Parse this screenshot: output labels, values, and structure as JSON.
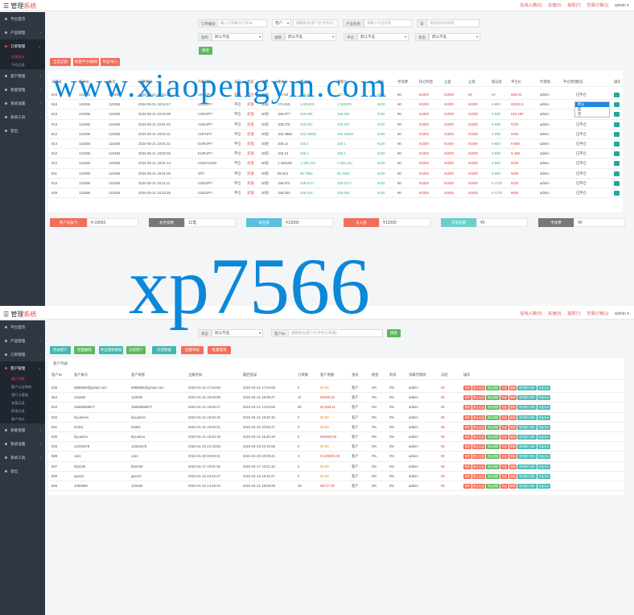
{
  "brand": {
    "title": "管理",
    "accent": "系统"
  },
  "topbar": {
    "links": [
      "在线人数(0)",
      "充值(0)",
      "提现(7)",
      "交易订单(1)"
    ],
    "user": "admin ▾"
  },
  "sidebar": {
    "items": [
      {
        "label": "平台首页"
      },
      {
        "label": "产品管理"
      },
      {
        "label": "订单管理"
      },
      {
        "label": "客户管理"
      },
      {
        "label": "资金管理"
      },
      {
        "label": "系统设置"
      },
      {
        "label": "系统工具"
      },
      {
        "label": "退出"
      }
    ],
    "subs1": [
      "交易流水",
      "平仓记录"
    ],
    "subs2": [
      "客户列表",
      "客户认证审核",
      "银行卡管理",
      "充值记录",
      "提现记录",
      "客户流水"
    ]
  },
  "filters1": {
    "order_no_label": "订单编号",
    "order_no_placeholder": "输入订单编号/订单ID",
    "client_select": "客户",
    "client_placeholder": "模糊查询(客户名/手机号)",
    "product_label": "产品名称",
    "product_placeholder": "请输入产品名称",
    "date_label": "日",
    "date_placeholder": "请选择开始日期",
    "row2": [
      {
        "label": "盈利",
        "value": "默认不选"
      },
      {
        "label": "涨跌",
        "value": "默认不选"
      },
      {
        "label": "平仓",
        "value": "默认不选"
      },
      {
        "label": "状态",
        "value": "默认不选"
      }
    ],
    "search": "搜索"
  },
  "actions1": {
    "a": "全选全部",
    "b": "批量平仓/删除",
    "c": "导出/导入"
  },
  "orders": {
    "headers": [
      "订单号",
      "客户ID",
      "账号",
      "订单时间",
      "产品代码",
      "方向",
      "状态",
      "手数",
      "建仓价",
      "建仓价",
      "最新价",
      "盈亏",
      "手续费",
      "持仓利息",
      "止盈",
      "止损",
      "保证金",
      "平仓价",
      "代理商",
      "平仓原因",
      "状态"
    ],
    "rows": [
      [
        "816",
        "123456",
        "123456",
        "2024-05-21 19:04:17",
        "USD/JPY",
        "买涨",
        "持仓",
        "30倍",
        "157.83",
        "158.221",
        "157.824",
        "¥100",
        "¥0",
        "¥1000",
        "¥1000",
        "¥0",
        "¥0",
        "¥95.03",
        "admin",
        "",
        "已平仓"
      ],
      [
        "815",
        "123456",
        "123456",
        "2024-05-21 19:04:17",
        "USD/JPY",
        "平仓",
        "买涨",
        "30倍",
        "171.815",
        "1.025576",
        "1.025576",
        "¥100",
        "¥0",
        "¥1000",
        "¥1000",
        "¥1000",
        "¥-880",
        "¥9153.8",
        "admin",
        "",
        "已平仓"
      ],
      [
        "813",
        "123456",
        "123456",
        "2024-05-21 19:03:39",
        "USD/JPY",
        "平仓",
        "买涨",
        "30倍",
        "156.977",
        "156.984",
        "156.984",
        "¥100",
        "¥0",
        "¥1000",
        "¥1000",
        "¥1000",
        "¥-880",
        "¥10,290",
        "admin",
        "",
        "已平仓"
      ],
      [
        "813",
        "123456",
        "123456",
        "2024-05-21 19:01:46",
        "AUD/JPY",
        "平仓",
        "买涨",
        "30倍",
        "108.278",
        "100.257",
        "100.257",
        "¥100",
        "¥0",
        "¥1000",
        "¥1000",
        "¥1000",
        "¥-880",
        "¥720",
        "admin",
        "",
        "已平仓"
      ],
      [
        "812",
        "123456",
        "123456",
        "2024-05-21 19:01:31",
        "CHF/JPY",
        "平仓",
        "买涨",
        "30倍",
        "162.4868",
        "163.20884",
        "163.20884",
        "¥100",
        "¥0",
        "¥1000",
        "¥1000",
        "¥1000",
        "¥-880",
        "¥160",
        "admin",
        "",
        "已平仓"
      ],
      [
        "814",
        "123456",
        "123456",
        "2024-05-21 19:01:31",
        "EUR/JPY",
        "平仓",
        "买涨",
        "30倍",
        "105.12",
        "105.1",
        "105.1",
        "¥100",
        "¥0",
        "¥1000",
        "¥1000",
        "¥1000",
        "¥-880",
        "¥-580",
        "admin",
        "",
        "已平仓"
      ],
      [
        "812",
        "123456",
        "123456",
        "2024-05-21 19:00:36",
        "EUR/JPY",
        "平仓",
        "买涨",
        "30倍",
        "105.13",
        "105.1",
        "105.1",
        "¥100",
        "¥0",
        "¥1000",
        "¥1000",
        "¥1000",
        "¥-880",
        "¥-180",
        "admin",
        "",
        "已平仓"
      ],
      [
        "812",
        "123456",
        "123456",
        "2024-05-21 19:01:14",
        "USD/AUDM",
        "平仓",
        "买涨",
        "30倍",
        "1.325180",
        "1.325,151",
        "1.325,151",
        "¥100",
        "¥0",
        "¥1000",
        "¥1000",
        "¥1000",
        "¥-880",
        "¥440",
        "admin",
        "",
        "已平仓"
      ],
      [
        "811",
        "123456",
        "123456",
        "2024-05-21 19:01:06",
        "WTI",
        "平仓",
        "买涨",
        "30倍",
        "85.813",
        "85.7963",
        "85.7963",
        "¥100",
        "¥0",
        "¥1000",
        "¥1000",
        "¥1000",
        "¥-880",
        "¥160",
        "admin",
        "",
        "已平仓"
      ],
      [
        "810",
        "123456",
        "123456",
        "2024-05-21 18:11:11",
        "USD/JPY",
        "平仓",
        "买涨",
        "30倍",
        "158.974",
        "159.5717",
        "159.5717",
        "¥100",
        "¥0",
        "¥1000",
        "¥1000",
        "¥1000",
        "¥-1700",
        "¥240",
        "admin",
        "",
        "已平仓"
      ],
      [
        "809",
        "123456",
        "123456",
        "2024-05-21 16:53:28",
        "USD/JPY",
        "平仓",
        "买涨",
        "30倍",
        "158.933",
        "158.918",
        "158.918",
        "¥100",
        "¥0",
        "¥1000",
        "¥2000",
        "¥2000",
        "¥-1700",
        "¥600",
        "admin",
        "",
        "已平仓"
      ]
    ]
  },
  "dropdown": {
    "options": [
      "默认",
      "是",
      "否"
    ]
  },
  "stats": [
    {
      "label": "客户总盈亏",
      "value": "¥-10560"
    },
    {
      "label": "总手续费",
      "value": "11笔"
    },
    {
      "label": "总出金",
      "value": "¥13000"
    },
    {
      "label": "总入金",
      "value": "¥12000"
    },
    {
      "label": "交易总量",
      "value": "¥0"
    },
    {
      "label": "手续费",
      "value": "¥0"
    }
  ],
  "filters2": {
    "status_label": "状态",
    "status_value": "默认不选",
    "client_label": "客户ID",
    "client_placeholder": "模糊查询(客户名/手机号/邮箱)",
    "search": "搜索"
  },
  "actions2": [
    "添加客户",
    "批量删除",
    "导出搜索数据",
    "冻结客户",
    "冻结数据",
    "批量审核",
    "批量提现"
  ],
  "clients_title": "客户列表",
  "clients": {
    "headers": [
      "客户ID",
      "客户账号",
      "客户昵称",
      "注册时间",
      "最后登录",
      "订单数",
      "客户余额",
      "身份",
      "佣金",
      "利率",
      "归属代理商",
      "冻结",
      "操作"
    ],
    "rows": [
      [
        "845",
        "6898686@gmail.com",
        "6898686@gmail.com",
        "2024-01-21 17:54:59",
        "2024-01-21 17:54:59",
        "0",
        "¥0.00",
        "客户",
        "0%",
        "0%",
        "admin",
        "¥0"
      ],
      [
        "864",
        "123456",
        "123456",
        "2024-01-21 16:48:59",
        "2024-01-21 15:08:27",
        "11",
        "¥8168.02",
        "客户",
        "0%",
        "0%",
        "admin",
        "¥0"
      ],
      [
        "833",
        "15558668677",
        "15558668677",
        "2024-01-21 19:56:47",
        "2024-01-21 14:52:06",
        "80",
        "¥2,588.11",
        "客户",
        "0%",
        "0%",
        "admin",
        "¥0"
      ],
      [
        "832",
        "kiyuaimei",
        "kiyuaimei",
        "2024-01-21 19:40:15",
        "2024-01-21 19:40:15",
        "0",
        "¥0.00",
        "客户",
        "0%",
        "0%",
        "admin",
        "¥0"
      ],
      [
        "831",
        "54321",
        "54321",
        "2024-01-21 16:00:21",
        "2024-01-21 20:56:27",
        "0",
        "¥0.00",
        "客户",
        "0%",
        "0%",
        "admin",
        "¥0"
      ],
      [
        "830",
        "kiyuaimu",
        "kiyuaimu",
        "2024-01-21 15:40:19",
        "2024-01-21 15:40:19",
        "0",
        "¥81850.00",
        "客户",
        "0%",
        "0%",
        "admin",
        "¥0"
      ],
      [
        "808",
        "12345678",
        "12345678",
        "2024-01-20 22:19:56",
        "2024-01-20 22:19:56",
        "0",
        "¥0.00",
        "客户",
        "0%",
        "0%",
        "admin",
        "¥0"
      ],
      [
        "888",
        "1111",
        "1111",
        "2024-01-20 20:48:21",
        "2024-01-20 20:08:21",
        "3",
        "¥-100000.00",
        "客户",
        "0%",
        "0%",
        "admin",
        "¥0"
      ],
      [
        "807",
        "552238",
        "552238",
        "2024-01-17 10:01:32",
        "2024-01-17 10:01:32",
        "0",
        "¥0.00",
        "客户",
        "0%",
        "0%",
        "admin",
        "¥0"
      ],
      [
        "806",
        "qwe22",
        "qwe22",
        "2024-01-16 15:42:47",
        "2024-01-16 15:42:47",
        "0",
        "¥0.00",
        "客户",
        "0%",
        "0%",
        "admin",
        "¥0"
      ],
      [
        "805",
        "1000869",
        "123456",
        "2024-01-16 14:45:23",
        "2024-01-21 18:08:29",
        "16",
        "¥8717.00",
        "客户",
        "0%",
        "0%",
        "admin",
        "¥0"
      ]
    ],
    "row_actions": [
      "修改",
      "禁止出金",
      "资金调整",
      "冻结",
      "删除",
      "修改银行资料",
      "资金流水"
    ]
  },
  "watermark": {
    "site": "www.xiaopengym.com",
    "code": "xp7566"
  },
  "colors": {
    "accent": "#e84a4a",
    "sidebar": "#2f3742",
    "green": "#5cb85c",
    "teal": "#43b8b1",
    "watermark": "#0b88d8"
  }
}
